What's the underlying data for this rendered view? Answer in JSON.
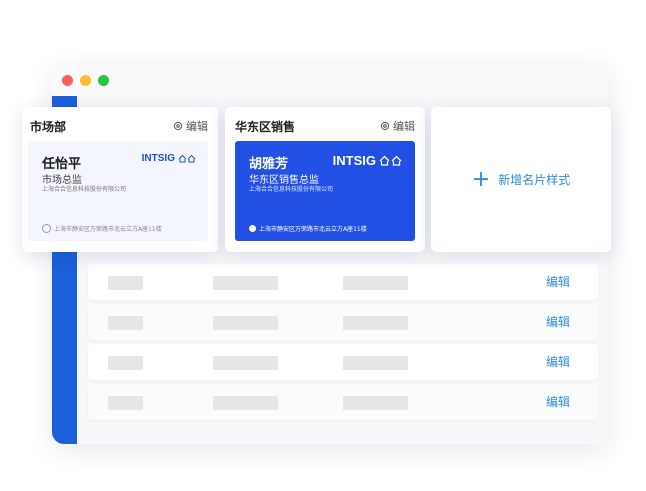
{
  "cards": [
    {
      "group": "市场部",
      "edit_label": "编辑",
      "name": "任怡平",
      "title": "市场总监",
      "company": "上海合合信息科技股份有限公司",
      "address": "上海市静安区万荣路市北云立方A座11楼",
      "logo_text": "INTSIG",
      "theme": "light",
      "bg": "#f3f6fe",
      "accent": "#1d4fd6"
    },
    {
      "group": "华东区销售",
      "edit_label": "编辑",
      "name": "胡雅芳",
      "title": "华东区销售总监",
      "company": "上海合合信息科技股份有限公司",
      "address": "上海市静安区万荣路市北云立方A座11楼",
      "logo_text": "INTSIG",
      "theme": "dark",
      "bg": "#2350e4",
      "accent": "#ffffff"
    }
  ],
  "add_card": {
    "label": "新增名片样式",
    "icon": "plus-icon"
  },
  "table": {
    "rows": [
      {
        "edit_label": "编辑"
      },
      {
        "edit_label": "编辑"
      },
      {
        "edit_label": "编辑"
      },
      {
        "edit_label": "编辑"
      }
    ]
  },
  "colors": {
    "primary": "#2b8be8",
    "sidebar": "#1c5fdc",
    "card_blue": "#2350e4"
  }
}
